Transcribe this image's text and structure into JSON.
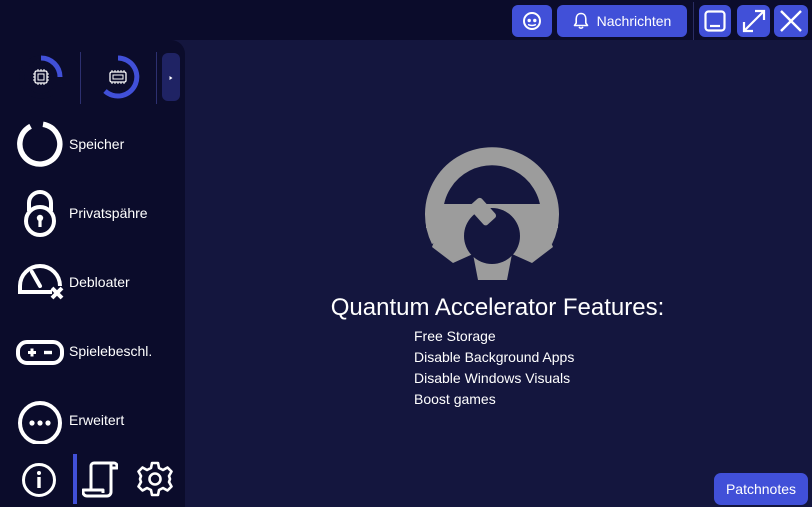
{
  "topbar": {
    "notifications_label": "Nachrichten",
    "icons": [
      "discord-icon",
      "bell-icon",
      "minimize-icon",
      "maximize-icon",
      "close-icon"
    ]
  },
  "sidebar": {
    "gauges": [
      {
        "name": "cpu-usage-gauge",
        "icon": "cpu-icon"
      },
      {
        "name": "gpu-usage-gauge",
        "icon": "gpu-icon"
      }
    ],
    "items": [
      {
        "label": "Speicher",
        "icon": "storage-ring-icon"
      },
      {
        "label": "Privatspähre",
        "icon": "lock-icon"
      },
      {
        "label": "Debloater",
        "icon": "speedometer-x-icon"
      },
      {
        "label": "Spielebeschl.",
        "icon": "gamepad-icon"
      },
      {
        "label": "Erweitert",
        "icon": "more-icon"
      }
    ],
    "bottom_icons": [
      "info-icon",
      "scroll-icon",
      "settings-icon"
    ]
  },
  "main": {
    "title": "Quantum Accelerator Features:",
    "features": [
      "Free Storage",
      "Disable Background Apps",
      "Disable Windows Visuals",
      "Boost games"
    ]
  },
  "footer": {
    "patchnotes_label": "Patchnotes"
  },
  "colors": {
    "background": "#14163e",
    "panel": "#0b0c2b",
    "accent": "#4150d8",
    "logo": "#9c9c9c"
  }
}
